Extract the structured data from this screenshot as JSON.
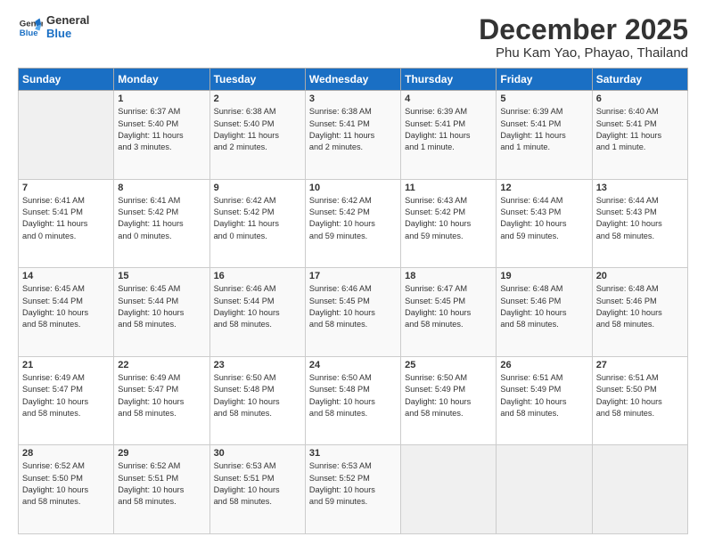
{
  "header": {
    "logo_line1": "General",
    "logo_line2": "Blue",
    "title": "December 2025",
    "subtitle": "Phu Kam Yao, Phayao, Thailand"
  },
  "days_of_week": [
    "Sunday",
    "Monday",
    "Tuesday",
    "Wednesday",
    "Thursday",
    "Friday",
    "Saturday"
  ],
  "weeks": [
    [
      {
        "num": "",
        "info": ""
      },
      {
        "num": "1",
        "info": "Sunrise: 6:37 AM\nSunset: 5:40 PM\nDaylight: 11 hours\nand 3 minutes."
      },
      {
        "num": "2",
        "info": "Sunrise: 6:38 AM\nSunset: 5:40 PM\nDaylight: 11 hours\nand 2 minutes."
      },
      {
        "num": "3",
        "info": "Sunrise: 6:38 AM\nSunset: 5:41 PM\nDaylight: 11 hours\nand 2 minutes."
      },
      {
        "num": "4",
        "info": "Sunrise: 6:39 AM\nSunset: 5:41 PM\nDaylight: 11 hours\nand 1 minute."
      },
      {
        "num": "5",
        "info": "Sunrise: 6:39 AM\nSunset: 5:41 PM\nDaylight: 11 hours\nand 1 minute."
      },
      {
        "num": "6",
        "info": "Sunrise: 6:40 AM\nSunset: 5:41 PM\nDaylight: 11 hours\nand 1 minute."
      }
    ],
    [
      {
        "num": "7",
        "info": "Sunrise: 6:41 AM\nSunset: 5:41 PM\nDaylight: 11 hours\nand 0 minutes."
      },
      {
        "num": "8",
        "info": "Sunrise: 6:41 AM\nSunset: 5:42 PM\nDaylight: 11 hours\nand 0 minutes."
      },
      {
        "num": "9",
        "info": "Sunrise: 6:42 AM\nSunset: 5:42 PM\nDaylight: 11 hours\nand 0 minutes."
      },
      {
        "num": "10",
        "info": "Sunrise: 6:42 AM\nSunset: 5:42 PM\nDaylight: 10 hours\nand 59 minutes."
      },
      {
        "num": "11",
        "info": "Sunrise: 6:43 AM\nSunset: 5:42 PM\nDaylight: 10 hours\nand 59 minutes."
      },
      {
        "num": "12",
        "info": "Sunrise: 6:44 AM\nSunset: 5:43 PM\nDaylight: 10 hours\nand 59 minutes."
      },
      {
        "num": "13",
        "info": "Sunrise: 6:44 AM\nSunset: 5:43 PM\nDaylight: 10 hours\nand 58 minutes."
      }
    ],
    [
      {
        "num": "14",
        "info": "Sunrise: 6:45 AM\nSunset: 5:44 PM\nDaylight: 10 hours\nand 58 minutes."
      },
      {
        "num": "15",
        "info": "Sunrise: 6:45 AM\nSunset: 5:44 PM\nDaylight: 10 hours\nand 58 minutes."
      },
      {
        "num": "16",
        "info": "Sunrise: 6:46 AM\nSunset: 5:44 PM\nDaylight: 10 hours\nand 58 minutes."
      },
      {
        "num": "17",
        "info": "Sunrise: 6:46 AM\nSunset: 5:45 PM\nDaylight: 10 hours\nand 58 minutes."
      },
      {
        "num": "18",
        "info": "Sunrise: 6:47 AM\nSunset: 5:45 PM\nDaylight: 10 hours\nand 58 minutes."
      },
      {
        "num": "19",
        "info": "Sunrise: 6:48 AM\nSunset: 5:46 PM\nDaylight: 10 hours\nand 58 minutes."
      },
      {
        "num": "20",
        "info": "Sunrise: 6:48 AM\nSunset: 5:46 PM\nDaylight: 10 hours\nand 58 minutes."
      }
    ],
    [
      {
        "num": "21",
        "info": "Sunrise: 6:49 AM\nSunset: 5:47 PM\nDaylight: 10 hours\nand 58 minutes."
      },
      {
        "num": "22",
        "info": "Sunrise: 6:49 AM\nSunset: 5:47 PM\nDaylight: 10 hours\nand 58 minutes."
      },
      {
        "num": "23",
        "info": "Sunrise: 6:50 AM\nSunset: 5:48 PM\nDaylight: 10 hours\nand 58 minutes."
      },
      {
        "num": "24",
        "info": "Sunrise: 6:50 AM\nSunset: 5:48 PM\nDaylight: 10 hours\nand 58 minutes."
      },
      {
        "num": "25",
        "info": "Sunrise: 6:50 AM\nSunset: 5:49 PM\nDaylight: 10 hours\nand 58 minutes."
      },
      {
        "num": "26",
        "info": "Sunrise: 6:51 AM\nSunset: 5:49 PM\nDaylight: 10 hours\nand 58 minutes."
      },
      {
        "num": "27",
        "info": "Sunrise: 6:51 AM\nSunset: 5:50 PM\nDaylight: 10 hours\nand 58 minutes."
      }
    ],
    [
      {
        "num": "28",
        "info": "Sunrise: 6:52 AM\nSunset: 5:50 PM\nDaylight: 10 hours\nand 58 minutes."
      },
      {
        "num": "29",
        "info": "Sunrise: 6:52 AM\nSunset: 5:51 PM\nDaylight: 10 hours\nand 58 minutes."
      },
      {
        "num": "30",
        "info": "Sunrise: 6:53 AM\nSunset: 5:51 PM\nDaylight: 10 hours\nand 58 minutes."
      },
      {
        "num": "31",
        "info": "Sunrise: 6:53 AM\nSunset: 5:52 PM\nDaylight: 10 hours\nand 59 minutes."
      },
      {
        "num": "",
        "info": ""
      },
      {
        "num": "",
        "info": ""
      },
      {
        "num": "",
        "info": ""
      }
    ]
  ]
}
